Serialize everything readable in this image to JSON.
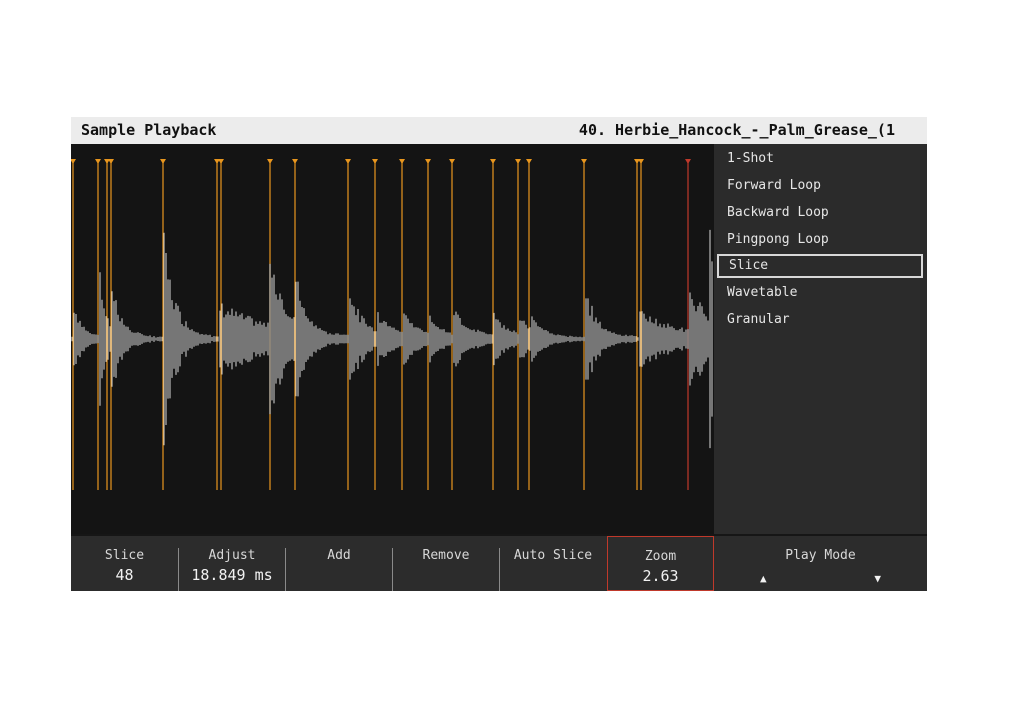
{
  "header": {
    "title": "Sample Playback",
    "sample_name": "40. Herbie_Hancock_-_Palm_Grease_(1"
  },
  "play_modes": [
    {
      "label": "1-Shot",
      "selected": false
    },
    {
      "label": "Forward Loop",
      "selected": false
    },
    {
      "label": "Backward Loop",
      "selected": false
    },
    {
      "label": "Pingpong Loop",
      "selected": false
    },
    {
      "label": "Slice",
      "selected": true
    },
    {
      "label": "Wavetable",
      "selected": false
    },
    {
      "label": "Granular",
      "selected": false
    }
  ],
  "softkeys": {
    "slice": {
      "label": "Slice",
      "value": "48"
    },
    "adjust": {
      "label": "Adjust",
      "value": "18.849 ms"
    },
    "add": {
      "label": "Add"
    },
    "remove": {
      "label": "Remove"
    },
    "auto_slice": {
      "label": "Auto Slice"
    },
    "zoom": {
      "label": "Zoom",
      "value": "2.63"
    },
    "play_mode": {
      "label": "Play Mode",
      "up_icon": "triangle-up-icon",
      "down_icon": "triangle-down-icon"
    }
  },
  "colors": {
    "slice_marker": "#e8961e",
    "active_slice_marker": "#c0392b",
    "waveform": "#d9d9d9",
    "zoom_highlight": "#c0392b"
  }
}
